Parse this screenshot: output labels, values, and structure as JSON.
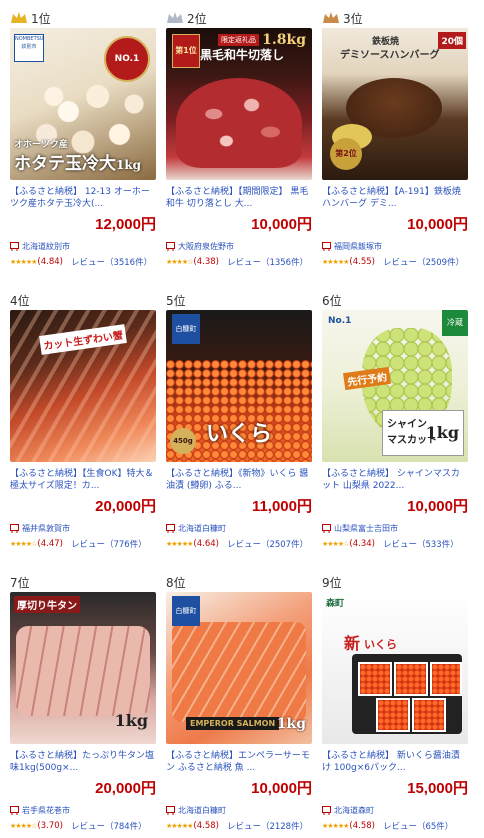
{
  "items": [
    {
      "rank": "1位",
      "crown": "gold",
      "title": "【ふるさと納税】 12-13 オーホーツク産ホタテ玉冷大(...",
      "price": "12,000円",
      "location": "北海道紋別市",
      "score": "(4.84)",
      "reviews": "レビュー（3516件）",
      "img": {
        "badge_top": "NOMBETSU 紋別市",
        "label1": "オホーツク産",
        "label2": "ホタテ玉冷大",
        "label3": "1kg",
        "seal": "NO.1"
      }
    },
    {
      "rank": "2位",
      "crown": "silver",
      "title": "【ふるさと納税】【期間限定】 黒毛和牛 切り落とし 大...",
      "price": "10,000円",
      "location": "大阪府泉佐野市",
      "score": "(4.38)",
      "reviews": "レビュー（1356件）",
      "img": {
        "label1": "黒毛和牛切落し",
        "label2": "1.8kg",
        "badge": "第1位",
        "band": "限定返礼品"
      }
    },
    {
      "rank": "3位",
      "crown": "bronze",
      "title": "【ふるさと納税】【A-191】鉄板焼 ハンバーグ デミ...",
      "price": "10,000円",
      "location": "福岡県飯塚市",
      "score": "(4.55)",
      "reviews": "レビュー（2509件）",
      "img": {
        "label1": "鉄板焼",
        "label2": "デミソースハンバーグ",
        "label3": "20個",
        "badge": "第2位"
      }
    },
    {
      "rank": "4位",
      "crown": "",
      "title": "【ふるさと納税】【生食OK】特大＆極太サイズ限定！カ...",
      "price": "20,000円",
      "location": "福井県敦賀市",
      "score": "(4.47)",
      "reviews": "レビュー（776件）",
      "img": {
        "label1": "カット生ずわい蟹"
      }
    },
    {
      "rank": "5位",
      "crown": "",
      "title": "【ふるさと納税】《新物》いくら 醤油漬 (鱒卵) ふる...",
      "price": "11,000円",
      "location": "北海道白糠町",
      "score": "(4.64)",
      "reviews": "レビュー（2507件）",
      "img": {
        "label1": "白糠町",
        "label2": "いくら",
        "label3": "450g"
      }
    },
    {
      "rank": "6位",
      "crown": "",
      "title": "【ふるさと納税】 シャインマスカット 山梨県 2022...",
      "price": "10,000円",
      "location": "山梨県富士吉田市",
      "score": "(4.34)",
      "reviews": "レビュー（533件）",
      "img": {
        "label1": "シャイン",
        "label2": "マスカット",
        "label3": "1kg",
        "tag": "冷蔵",
        "badge": "No.1",
        "seal": "先行予約"
      }
    },
    {
      "rank": "7位",
      "crown": "",
      "title": "【ふるさと納税】たっぷり牛タン塩味1kg(500g×...",
      "price": "20,000円",
      "location": "岩手県花巻市",
      "score": "(3.70)",
      "reviews": "レビュー（784件）",
      "img": {
        "label1": "厚切り牛タン",
        "label2": "1kg"
      }
    },
    {
      "rank": "8位",
      "crown": "",
      "title": "【ふるさと納税】エンペラーサーモン ふるさと納税 魚 ...",
      "price": "10,000円",
      "location": "北海道白糠町",
      "score": "(4.58)",
      "reviews": "レビュー（2128件）",
      "img": {
        "label1": "白糠町",
        "label2": "EMPEROR SALMON",
        "label3": "1kg"
      }
    },
    {
      "rank": "9位",
      "crown": "",
      "title": "【ふるさと納税】 新いくら醤油漬け 100g×6パック...",
      "price": "15,000円",
      "location": "北海道森町",
      "score": "(4.58)",
      "reviews": "レビュー（65件）",
      "img": {
        "label1": "森町",
        "label2": "新",
        "label3": "いくら"
      }
    }
  ],
  "colors": {
    "price": "#bf0000",
    "link": "#2a52be",
    "star": "#f0a000",
    "gold": "#e6b422",
    "silver": "#b0b8c8",
    "bronze": "#c98a4a"
  },
  "icons": {
    "crown": "crown-icon",
    "pin": "location-pin-icon",
    "star": "star-icon"
  }
}
